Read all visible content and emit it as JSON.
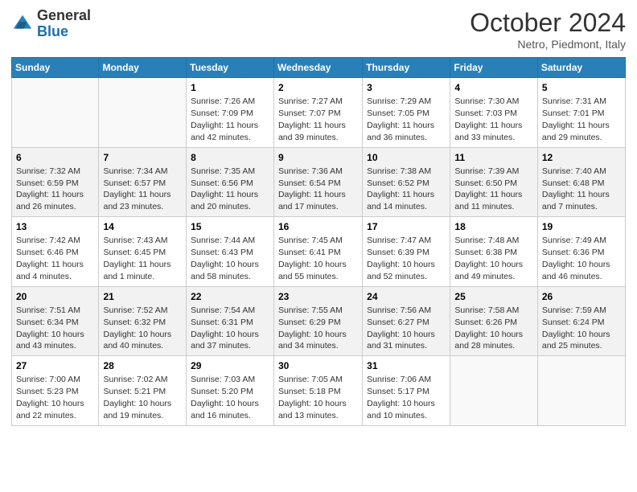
{
  "header": {
    "logo_general": "General",
    "logo_blue": "Blue",
    "month_title": "October 2024",
    "location": "Netro, Piedmont, Italy"
  },
  "days_of_week": [
    "Sunday",
    "Monday",
    "Tuesday",
    "Wednesday",
    "Thursday",
    "Friday",
    "Saturday"
  ],
  "weeks": [
    [
      {
        "day": "",
        "sunrise": "",
        "sunset": "",
        "daylight": ""
      },
      {
        "day": "",
        "sunrise": "",
        "sunset": "",
        "daylight": ""
      },
      {
        "day": "1",
        "sunrise": "Sunrise: 7:26 AM",
        "sunset": "Sunset: 7:09 PM",
        "daylight": "Daylight: 11 hours and 42 minutes."
      },
      {
        "day": "2",
        "sunrise": "Sunrise: 7:27 AM",
        "sunset": "Sunset: 7:07 PM",
        "daylight": "Daylight: 11 hours and 39 minutes."
      },
      {
        "day": "3",
        "sunrise": "Sunrise: 7:29 AM",
        "sunset": "Sunset: 7:05 PM",
        "daylight": "Daylight: 11 hours and 36 minutes."
      },
      {
        "day": "4",
        "sunrise": "Sunrise: 7:30 AM",
        "sunset": "Sunset: 7:03 PM",
        "daylight": "Daylight: 11 hours and 33 minutes."
      },
      {
        "day": "5",
        "sunrise": "Sunrise: 7:31 AM",
        "sunset": "Sunset: 7:01 PM",
        "daylight": "Daylight: 11 hours and 29 minutes."
      }
    ],
    [
      {
        "day": "6",
        "sunrise": "Sunrise: 7:32 AM",
        "sunset": "Sunset: 6:59 PM",
        "daylight": "Daylight: 11 hours and 26 minutes."
      },
      {
        "day": "7",
        "sunrise": "Sunrise: 7:34 AM",
        "sunset": "Sunset: 6:57 PM",
        "daylight": "Daylight: 11 hours and 23 minutes."
      },
      {
        "day": "8",
        "sunrise": "Sunrise: 7:35 AM",
        "sunset": "Sunset: 6:56 PM",
        "daylight": "Daylight: 11 hours and 20 minutes."
      },
      {
        "day": "9",
        "sunrise": "Sunrise: 7:36 AM",
        "sunset": "Sunset: 6:54 PM",
        "daylight": "Daylight: 11 hours and 17 minutes."
      },
      {
        "day": "10",
        "sunrise": "Sunrise: 7:38 AM",
        "sunset": "Sunset: 6:52 PM",
        "daylight": "Daylight: 11 hours and 14 minutes."
      },
      {
        "day": "11",
        "sunrise": "Sunrise: 7:39 AM",
        "sunset": "Sunset: 6:50 PM",
        "daylight": "Daylight: 11 hours and 11 minutes."
      },
      {
        "day": "12",
        "sunrise": "Sunrise: 7:40 AM",
        "sunset": "Sunset: 6:48 PM",
        "daylight": "Daylight: 11 hours and 7 minutes."
      }
    ],
    [
      {
        "day": "13",
        "sunrise": "Sunrise: 7:42 AM",
        "sunset": "Sunset: 6:46 PM",
        "daylight": "Daylight: 11 hours and 4 minutes."
      },
      {
        "day": "14",
        "sunrise": "Sunrise: 7:43 AM",
        "sunset": "Sunset: 6:45 PM",
        "daylight": "Daylight: 11 hours and 1 minute."
      },
      {
        "day": "15",
        "sunrise": "Sunrise: 7:44 AM",
        "sunset": "Sunset: 6:43 PM",
        "daylight": "Daylight: 10 hours and 58 minutes."
      },
      {
        "day": "16",
        "sunrise": "Sunrise: 7:45 AM",
        "sunset": "Sunset: 6:41 PM",
        "daylight": "Daylight: 10 hours and 55 minutes."
      },
      {
        "day": "17",
        "sunrise": "Sunrise: 7:47 AM",
        "sunset": "Sunset: 6:39 PM",
        "daylight": "Daylight: 10 hours and 52 minutes."
      },
      {
        "day": "18",
        "sunrise": "Sunrise: 7:48 AM",
        "sunset": "Sunset: 6:38 PM",
        "daylight": "Daylight: 10 hours and 49 minutes."
      },
      {
        "day": "19",
        "sunrise": "Sunrise: 7:49 AM",
        "sunset": "Sunset: 6:36 PM",
        "daylight": "Daylight: 10 hours and 46 minutes."
      }
    ],
    [
      {
        "day": "20",
        "sunrise": "Sunrise: 7:51 AM",
        "sunset": "Sunset: 6:34 PM",
        "daylight": "Daylight: 10 hours and 43 minutes."
      },
      {
        "day": "21",
        "sunrise": "Sunrise: 7:52 AM",
        "sunset": "Sunset: 6:32 PM",
        "daylight": "Daylight: 10 hours and 40 minutes."
      },
      {
        "day": "22",
        "sunrise": "Sunrise: 7:54 AM",
        "sunset": "Sunset: 6:31 PM",
        "daylight": "Daylight: 10 hours and 37 minutes."
      },
      {
        "day": "23",
        "sunrise": "Sunrise: 7:55 AM",
        "sunset": "Sunset: 6:29 PM",
        "daylight": "Daylight: 10 hours and 34 minutes."
      },
      {
        "day": "24",
        "sunrise": "Sunrise: 7:56 AM",
        "sunset": "Sunset: 6:27 PM",
        "daylight": "Daylight: 10 hours and 31 minutes."
      },
      {
        "day": "25",
        "sunrise": "Sunrise: 7:58 AM",
        "sunset": "Sunset: 6:26 PM",
        "daylight": "Daylight: 10 hours and 28 minutes."
      },
      {
        "day": "26",
        "sunrise": "Sunrise: 7:59 AM",
        "sunset": "Sunset: 6:24 PM",
        "daylight": "Daylight: 10 hours and 25 minutes."
      }
    ],
    [
      {
        "day": "27",
        "sunrise": "Sunrise: 7:00 AM",
        "sunset": "Sunset: 5:23 PM",
        "daylight": "Daylight: 10 hours and 22 minutes."
      },
      {
        "day": "28",
        "sunrise": "Sunrise: 7:02 AM",
        "sunset": "Sunset: 5:21 PM",
        "daylight": "Daylight: 10 hours and 19 minutes."
      },
      {
        "day": "29",
        "sunrise": "Sunrise: 7:03 AM",
        "sunset": "Sunset: 5:20 PM",
        "daylight": "Daylight: 10 hours and 16 minutes."
      },
      {
        "day": "30",
        "sunrise": "Sunrise: 7:05 AM",
        "sunset": "Sunset: 5:18 PM",
        "daylight": "Daylight: 10 hours and 13 minutes."
      },
      {
        "day": "31",
        "sunrise": "Sunrise: 7:06 AM",
        "sunset": "Sunset: 5:17 PM",
        "daylight": "Daylight: 10 hours and 10 minutes."
      },
      {
        "day": "",
        "sunrise": "",
        "sunset": "",
        "daylight": ""
      },
      {
        "day": "",
        "sunrise": "",
        "sunset": "",
        "daylight": ""
      }
    ]
  ]
}
